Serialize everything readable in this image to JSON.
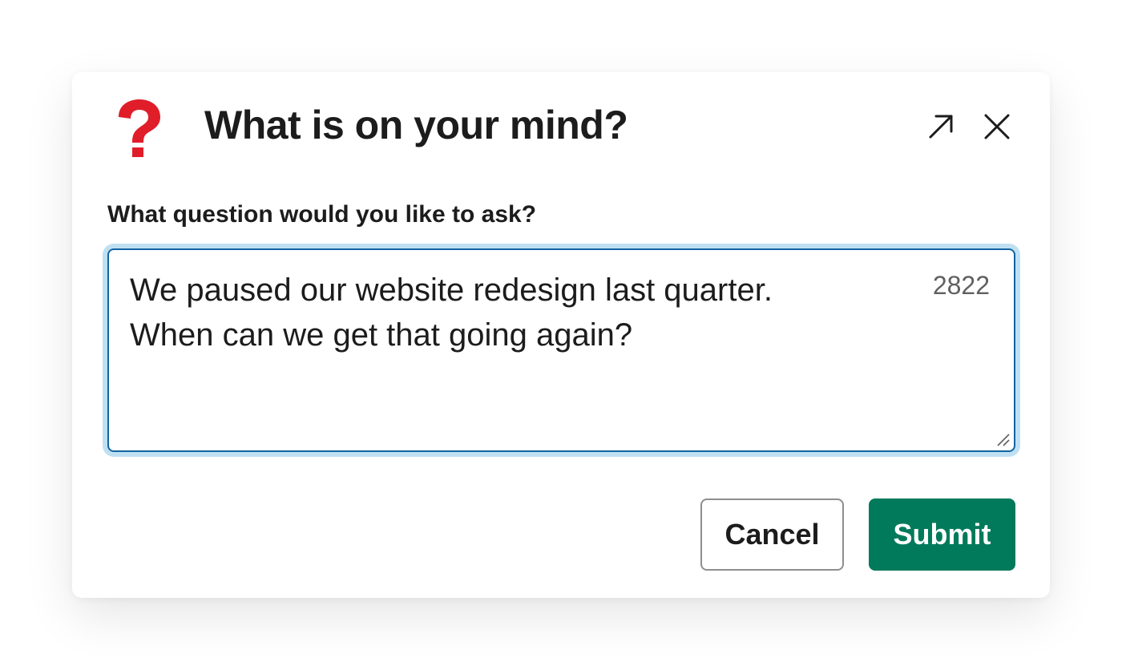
{
  "modal": {
    "title": "What is on your mind?",
    "header_icon": "question-mark-icon",
    "expand_icon": "expand-arrow-icon",
    "close_icon": "close-icon"
  },
  "question": {
    "label": "What question would you like to ask?",
    "value_lines": [
      "We paused our website redesign last quarter.",
      "When can we get that going again?"
    ],
    "char_count": "2822"
  },
  "actions": {
    "cancel_label": "Cancel",
    "submit_label": "Submit"
  },
  "colors": {
    "accent_question": "#e01e2a",
    "focus_border": "#1264a3",
    "focus_ring": "#bfe0f2",
    "submit_bg": "#007a5a",
    "text": "#1d1c1d",
    "muted_text": "#616061"
  }
}
